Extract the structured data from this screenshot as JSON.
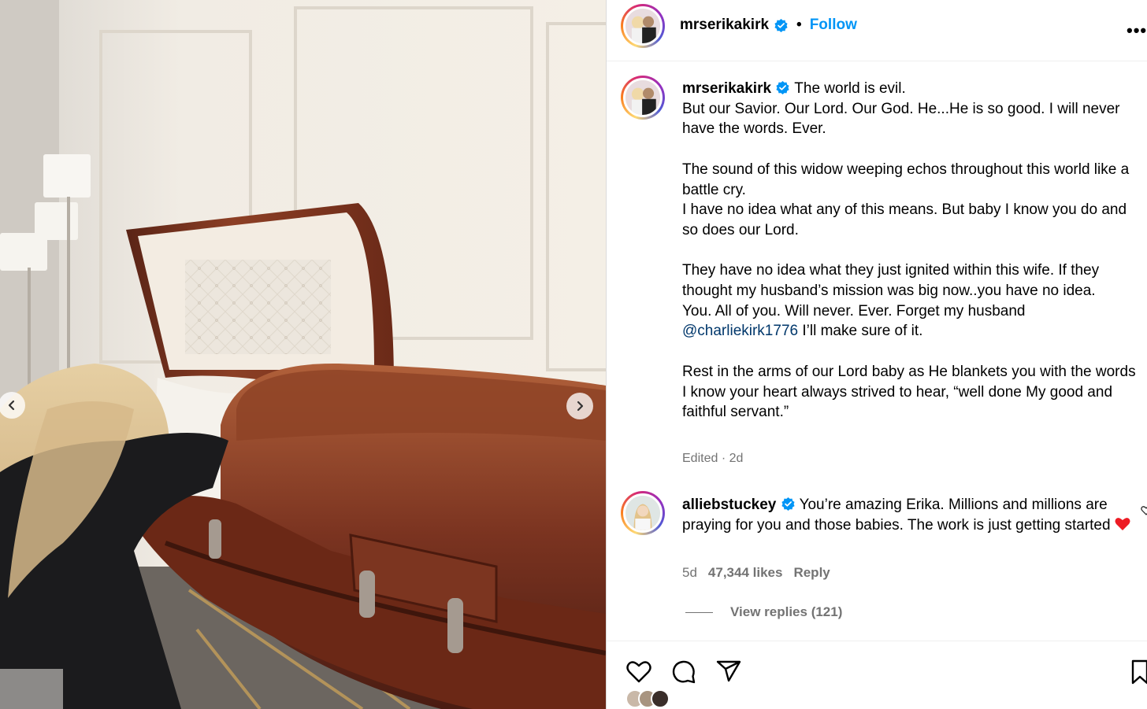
{
  "post": {
    "username": "mrserikakirk",
    "follow_label": "Follow",
    "separator": "•",
    "more_label": "•••",
    "caption_lines": [
      "The world is evil.",
      "But our Savior. Our Lord. Our God. He...He is so good. I will never have the words. Ever.",
      "",
      "The sound of this widow weeping echos throughout this world like a battle cry.",
      "I have no idea what any of this means. But baby I know you do and so does our Lord.",
      "",
      "They have no idea what they just ignited within this wife. If they thought my husband’s mission was big now..you have no idea.",
      "You. All of you. Will never. Ever. Forget my husband"
    ],
    "mention": "@charliekirk1776",
    "mention_suffix": " I’ll make sure of it.",
    "caption_tail": "Rest in the arms of our Lord baby as He blankets you with the words I know your heart always strived to hear, “well done My good and faithful servant.”",
    "edited_meta": "Edited · 2d"
  },
  "comment": {
    "username": "alliebstuckey",
    "text": "You’re amazing Erika. Millions and millions are praying for you and those babies. The work is just getting started",
    "age": "5d",
    "likes": "47,344 likes",
    "reply_label": "Reply",
    "view_replies": "View replies (121)"
  },
  "colors": {
    "link_blue": "#0095f6",
    "mention_blue": "#00376b",
    "muted": "#737373",
    "verified": "#0095f6",
    "heart_red": "#ed1c24"
  },
  "icons": [
    "chevron-left-icon",
    "chevron-right-icon",
    "verified-badge-icon",
    "heart-icon",
    "comment-icon",
    "share-icon",
    "bookmark-icon",
    "more-icon"
  ]
}
